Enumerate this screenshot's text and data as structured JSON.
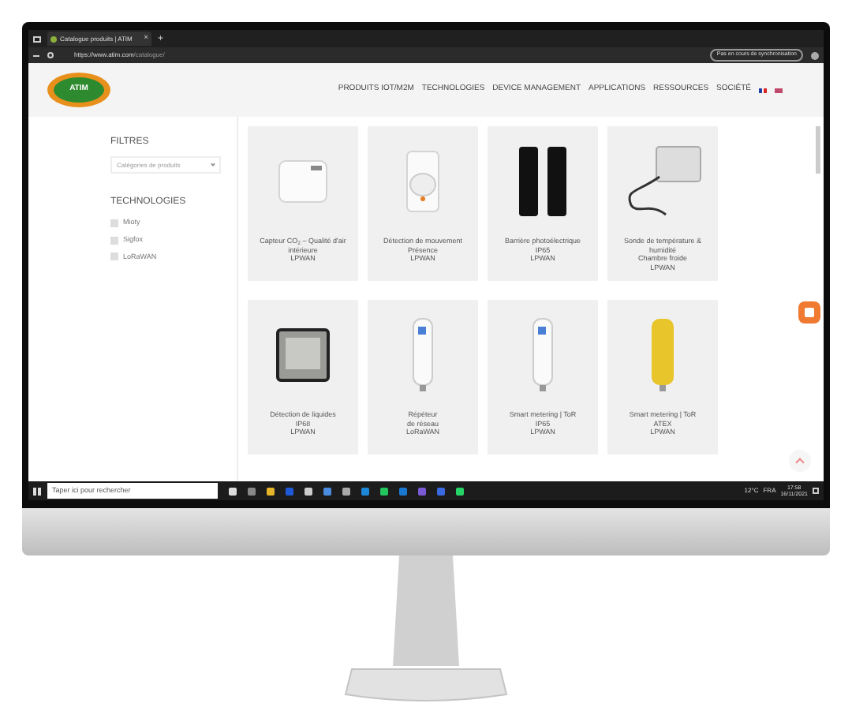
{
  "browser": {
    "tab_title": "Catalogue produits | ATIM",
    "tab_close": "×",
    "new_tab": "+",
    "url_host": "https://www.atim.com",
    "url_path": "/catalogue/",
    "sync_label": "Pas en cours de synchronisation"
  },
  "site": {
    "logo_text": "ATIM",
    "nav": [
      {
        "label": "PRODUITS IOT/M2M"
      },
      {
        "label": "TECHNOLOGIES"
      },
      {
        "label": "DEVICE MANAGEMENT"
      },
      {
        "label": "APPLICATIONS"
      },
      {
        "label": "RESSOURCES"
      },
      {
        "label": "SOCIÉTÉ"
      }
    ]
  },
  "filters": {
    "title": "FILTRES",
    "category_placeholder": "Catégories de produits",
    "tech_title": "TECHNOLOGIES",
    "options": [
      {
        "label": "Mioty",
        "checked": false
      },
      {
        "label": "Sigfox",
        "checked": false
      },
      {
        "label": "LoRaWAN",
        "checked": false
      }
    ]
  },
  "products": [
    {
      "kind": "sensor",
      "lines": [
        "Capteur CO$_{2}$ – Qualité d'air",
        "intérieure",
        "LPWAN"
      ]
    },
    {
      "kind": "motion",
      "lines": [
        "Détection de mouvement",
        "Présence",
        "LPWAN"
      ]
    },
    {
      "kind": "barrier",
      "lines": [
        "Barrière photoélectrique",
        "IP65",
        "LPWAN"
      ]
    },
    {
      "kind": "probe",
      "lines": [
        "Sonde de température &",
        "humidité",
        "Chambre froide",
        "LPWAN"
      ]
    },
    {
      "kind": "box",
      "lines": [
        "Détection de liquides",
        "IP68",
        "LPWAN"
      ]
    },
    {
      "kind": "tube",
      "lines": [
        "Répéteur",
        "de réseau",
        "LoRaWAN"
      ]
    },
    {
      "kind": "tube",
      "lines": [
        "Smart metering | ToR",
        "IP65",
        "LPWAN"
      ]
    },
    {
      "kind": "yellow",
      "lines": [
        "Smart metering | ToR",
        "ATEX",
        "LPWAN"
      ]
    }
  ],
  "taskbar": {
    "search_placeholder": "Taper ici pour rechercher",
    "temperature": "12°C",
    "language": "FRA",
    "time": "17:58",
    "date": "16/11/2021"
  }
}
